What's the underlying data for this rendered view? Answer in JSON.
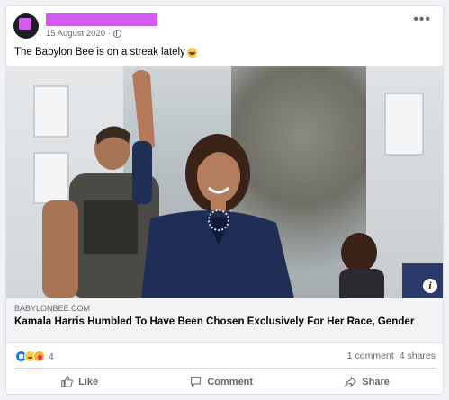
{
  "post": {
    "date": "15 August 2020",
    "separator": "·",
    "more_label": "•••",
    "caption": "The Babylon Bee is on a streak lately"
  },
  "link": {
    "domain": "BABYLONBEE.COM",
    "title": "Kamala Harris Humbled To Have Been Chosen Exclusively For Her Race, Gender"
  },
  "stats": {
    "reaction_count": "4",
    "comments": "1 comment",
    "shares": "4 shares",
    "reaction_icons": [
      "like",
      "haha",
      "care"
    ]
  },
  "actions": {
    "like": "Like",
    "comment": "Comment",
    "share": "Share"
  },
  "colors": {
    "redaction": "#d35bf0",
    "like_blue": "#1877f2",
    "muted_text": "#65676b"
  }
}
